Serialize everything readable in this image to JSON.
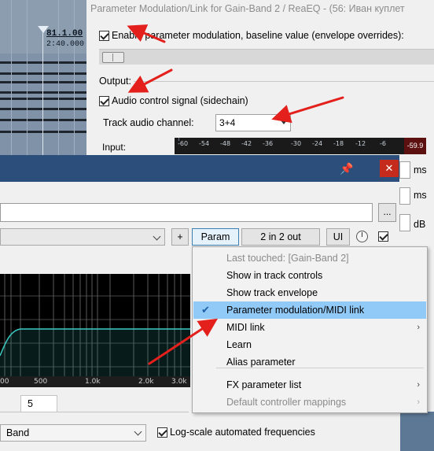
{
  "timeline": {
    "bar": "81.1.00",
    "seconds": "2:40.000"
  },
  "param_mod_window": {
    "title": "Parameter Modulation/Link for Gain-Band 2 / ReaEQ - (56: Иван куплет",
    "enable_label": "Enable parameter modulation, baseline value (envelope overrides):",
    "enable_checked": true,
    "output_label": "Output:",
    "audio_label": "Audio control signal (sidechain)",
    "audio_checked": true,
    "channel_label": "Track audio channel:",
    "channel_value": "3+4",
    "input_label": "Input:",
    "meter_ticks": [
      "-60",
      "-54",
      "-48",
      "-42",
      "-36",
      "-30",
      "-24",
      "-18",
      "-12",
      "-6"
    ],
    "meter_peak": "-59.9",
    "units": [
      "ms",
      "ms",
      "dB"
    ]
  },
  "fx_window": {
    "pin_glyph": "📌",
    "close_glyph": "✕",
    "preset_more": "...",
    "buttons": {
      "plus": "+",
      "param": "Param",
      "io": "2 in 2 out",
      "ui": "UI"
    },
    "bypass_checked": true,
    "axis_labels": [
      "00",
      "500",
      "1.0k",
      "2.0k",
      "3.0k"
    ],
    "band_tab": "5",
    "band_type": "Band",
    "logscale_label": "Log-scale automated frequencies",
    "logscale_checked": true
  },
  "context_menu": {
    "items": [
      {
        "label": "Last touched: [Gain-Band 2]",
        "disabled": true,
        "submenu": false,
        "checked": false,
        "highlighted": false
      },
      {
        "label": "Show in track controls",
        "disabled": false,
        "submenu": false,
        "checked": false,
        "highlighted": false
      },
      {
        "label": "Show track envelope",
        "disabled": false,
        "submenu": false,
        "checked": false,
        "highlighted": false
      },
      {
        "label": "Parameter modulation/MIDI link",
        "disabled": false,
        "submenu": false,
        "checked": true,
        "highlighted": true
      },
      {
        "label": "MIDI link",
        "disabled": false,
        "submenu": true,
        "checked": false,
        "highlighted": false
      },
      {
        "label": "Learn",
        "disabled": false,
        "submenu": false,
        "checked": false,
        "highlighted": false
      },
      {
        "label": "Alias parameter",
        "disabled": false,
        "submenu": false,
        "checked": false,
        "highlighted": false
      },
      {
        "label": "FX parameter list",
        "disabled": false,
        "submenu": true,
        "checked": false,
        "highlighted": false
      },
      {
        "label": "Default controller mappings",
        "disabled": true,
        "submenu": true,
        "checked": false,
        "highlighted": false
      }
    ],
    "submenu_glyph": "›",
    "check_glyph": "✔"
  },
  "colors": {
    "titlebar": "#2b4f7a",
    "highlight": "#91c9f7",
    "arrow": "#e3201b",
    "eq_curve": "#3fd0c8",
    "meter_peak": "#5c1010"
  }
}
